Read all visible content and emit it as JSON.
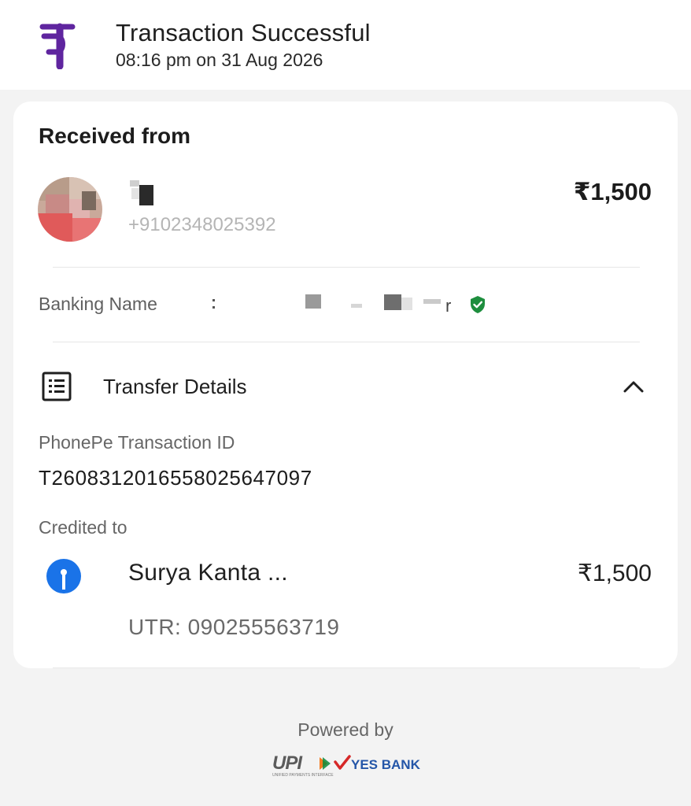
{
  "header": {
    "logo_icon": "phonepe-logo-icon",
    "title": "Transaction Successful",
    "subtitle": "08:16 pm on 31 Aug 2026"
  },
  "received": {
    "title": "Received from",
    "avatar_icon": "sender-avatar",
    "phone": "+9102348025392",
    "amount": "₹1,500"
  },
  "banking": {
    "label": "Banking Name",
    "verified_icon": "verified-shield-icon"
  },
  "transfer": {
    "icon": "receipt-list-icon",
    "label": "Transfer Details",
    "chevron_icon": "chevron-up-icon",
    "txn_id_label": "PhonePe Transaction ID",
    "txn_id": "T2608312016558025647097",
    "credited_label": "Credited to",
    "bank_icon": "sbi-bank-icon",
    "credited_name": "Surya Kanta ...",
    "credited_amount": "₹1,500",
    "utr": "UTR: 090255563719"
  },
  "footer": {
    "powered_by": "Powered by",
    "upi_logo_text": "UPI",
    "upi_subtext": "UNIFIED PAYMENTS INTERFACE",
    "yes_bank_text": "YES BANK"
  },
  "colors": {
    "phonepe_purple": "#5f259f",
    "verified_green": "#1e8e3e",
    "sbi_blue": "#1a73e8",
    "yes_bank_blue": "#2456a8",
    "yes_bank_red": "#d62828"
  }
}
